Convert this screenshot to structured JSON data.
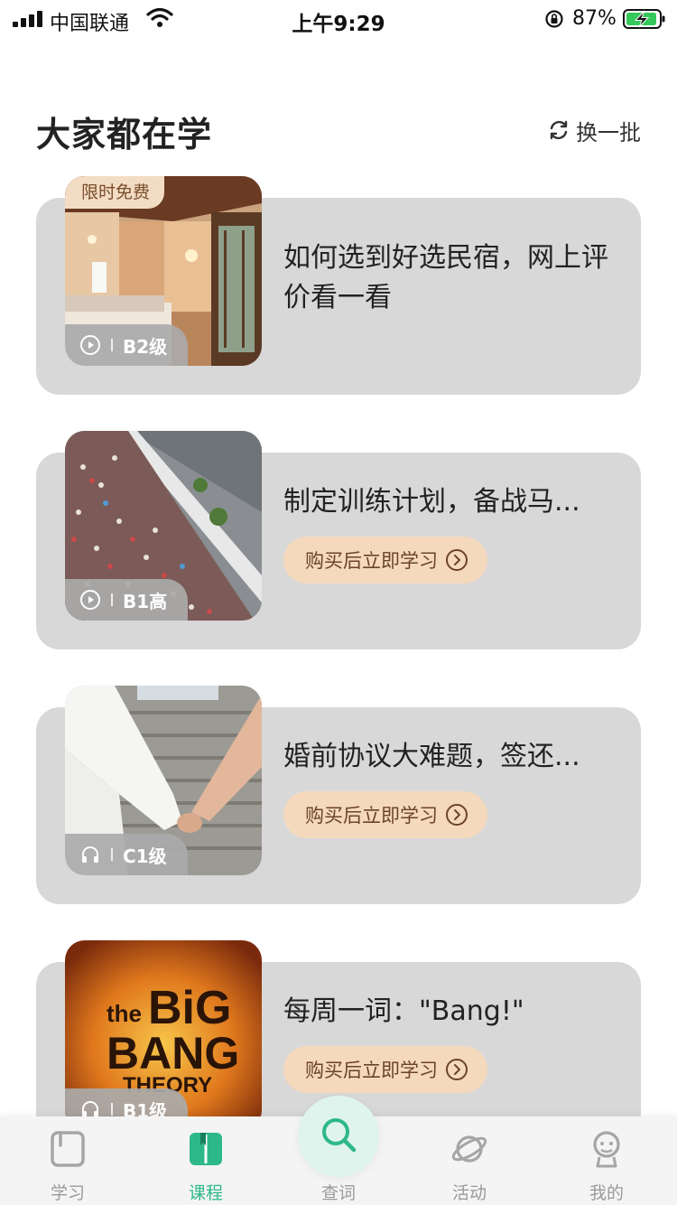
{
  "status_bar": {
    "carrier": "中国联通",
    "time": "上午9:29",
    "battery": "87%"
  },
  "section": {
    "title": "大家都在学",
    "refresh_label": "换一批"
  },
  "courses": [
    {
      "title": "如何选到好选民宿，网上评价看一看",
      "badge": "限时免费",
      "media": "play-icon",
      "level": "B2级",
      "button": ""
    },
    {
      "title": "制定训练计划，备战马...",
      "badge": "",
      "media": "play-icon",
      "level": "B1高",
      "button": "购买后立即学习"
    },
    {
      "title": "婚前协议大难题，签还...",
      "badge": "",
      "media": "headphones-icon",
      "level": "C1级",
      "button": "购买后立即学习"
    },
    {
      "title": "每周一词：\"Bang!\"",
      "badge": "",
      "media": "headphones-icon",
      "level": "B1级",
      "button": "购买后立即学习",
      "thumb_text": [
        "the",
        "BiG",
        "BANG",
        "THEORY"
      ]
    }
  ],
  "tabs": [
    {
      "label": "学习",
      "icon": "book-outline-icon",
      "active": false
    },
    {
      "label": "课程",
      "icon": "open-book-icon",
      "active": true
    },
    {
      "label": "查词",
      "icon": "search-icon",
      "active": false
    },
    {
      "label": "活动",
      "icon": "planet-icon",
      "active": false
    },
    {
      "label": "我的",
      "icon": "user-face-icon",
      "active": false
    }
  ],
  "colors": {
    "accent": "#2db88a",
    "card_bg": "#d8d8d8",
    "buy_button_bg": "#f5d9bd",
    "free_badge_bg": "#f3dcc4"
  }
}
